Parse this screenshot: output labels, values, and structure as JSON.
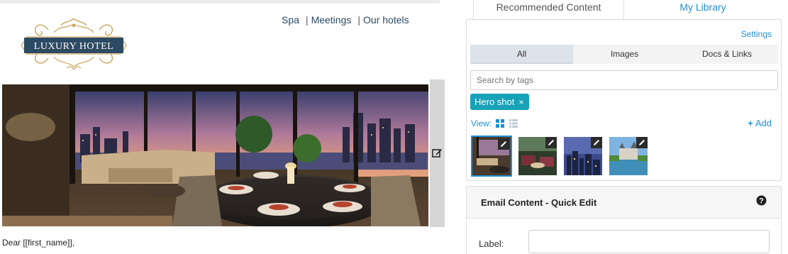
{
  "email": {
    "logo_text": "LUXURY HOTEL",
    "nav": [
      "Spa",
      "Meetings",
      "Our hotels"
    ],
    "nav_separator": "|",
    "greeting": "Dear [[first_name]],"
  },
  "panel": {
    "tabs": [
      {
        "label": "Recommended Content",
        "active": true
      },
      {
        "label": "My Library",
        "active": false
      }
    ],
    "settings_label": "Settings",
    "filters": [
      {
        "label": "All",
        "selected": true
      },
      {
        "label": "Images",
        "selected": false
      },
      {
        "label": "Docs & Links",
        "selected": false
      }
    ],
    "search_placeholder": "Search by tags",
    "tag_chip": {
      "label": "Hero shot",
      "remove": "×"
    },
    "view_label": "View:",
    "add_label": "Add",
    "thumbnails": [
      {
        "name": "hotel-suite",
        "selected": true
      },
      {
        "name": "lounge-seating",
        "selected": false
      },
      {
        "name": "city-night",
        "selected": false
      },
      {
        "name": "castle-lake",
        "selected": false
      }
    ],
    "quick_edit": {
      "title": "Email Content - Quick Edit",
      "label_field": "Label:",
      "label_value": ""
    }
  },
  "colors": {
    "accent": "#1f8fd6",
    "chip": "#17a2b8",
    "logo_navy": "#2c4a63",
    "logo_gold": "#c9a45c"
  },
  "icons": [
    "edit-icon",
    "pencil-icon",
    "grid-view-icon",
    "list-view-icon",
    "help-icon",
    "close-icon"
  ]
}
